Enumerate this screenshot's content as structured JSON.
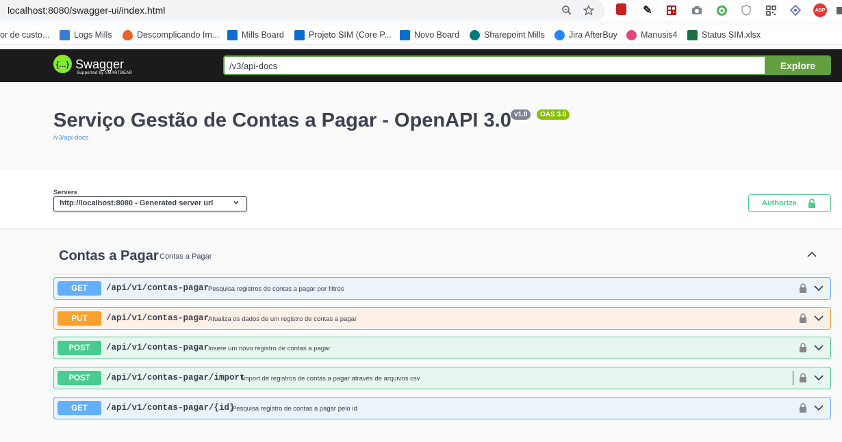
{
  "browser": {
    "url": "localhost:8080/swagger-ui/index.html",
    "bookmarks": [
      {
        "label": "or de custo...",
        "icon": "generic-icon",
        "color": "#ffffff"
      },
      {
        "label": "Logs Mills",
        "icon": "logs-icon",
        "color": "#3b7bd4"
      },
      {
        "label": "Descomplicando Im...",
        "icon": "flame-icon",
        "color": "#e8622a"
      },
      {
        "label": "Mills Board",
        "icon": "azure-devops-icon",
        "color": "#0a6fcc"
      },
      {
        "label": "Projeto SIM (Core P...",
        "icon": "azure-devops-icon",
        "color": "#0a6fcc"
      },
      {
        "label": "Novo Board",
        "icon": "azure-devops-icon",
        "color": "#0a6fcc"
      },
      {
        "label": "Sharepoint Mills",
        "icon": "sharepoint-icon",
        "color": "#03787c"
      },
      {
        "label": "Jira AfterBuy",
        "icon": "jira-icon",
        "color": "#2684ff"
      },
      {
        "label": "Manusis4",
        "icon": "manusis-icon",
        "color": "#e0457b"
      },
      {
        "label": "Status SIM.xlsx",
        "icon": "excel-icon",
        "color": "#1d6f42"
      }
    ]
  },
  "topbar": {
    "logo_text": "Swagger",
    "logo_sub": "Supported by SMARTBEAR",
    "logo_glyph": "{...}",
    "api_url": "/v3/api-docs",
    "explore_label": "Explore"
  },
  "info": {
    "title": "Serviço Gestão de Contas a Pagar - OpenAPI 3.0",
    "version_badge": "v1.0",
    "oas_badge": "OAS 3.0",
    "link": "/v3/api-docs",
    "version_color": "#7d8492",
    "oas_color": "#89bf04"
  },
  "servers": {
    "label": "Servers",
    "selected": "http://localhost:8080 - Generated server url",
    "authorize_label": "Authorize"
  },
  "tag": {
    "name": "Contas a Pagar",
    "description": "Contas a Pagar"
  },
  "operations": [
    {
      "method": "GET",
      "path": "/api/v1/contas-pagar",
      "summary": "Pesquisa registros de contas a pagar por filtros"
    },
    {
      "method": "PUT",
      "path": "/api/v1/contas-pagar",
      "summary": "Atualiza os dados de um registro de contas a pagar"
    },
    {
      "method": "POST",
      "path": "/api/v1/contas-pagar",
      "summary": "Insere um novo registro de contas a pagar"
    },
    {
      "method": "POST",
      "path": "/api/v1/contas-pagar/import",
      "summary": "Import de registros de contas a pagar através de arquivos csv"
    },
    {
      "method": "GET",
      "path": "/api/v1/contas-pagar/{id}",
      "summary": "Pesquisa registro de contas a pagar pelo id"
    }
  ]
}
